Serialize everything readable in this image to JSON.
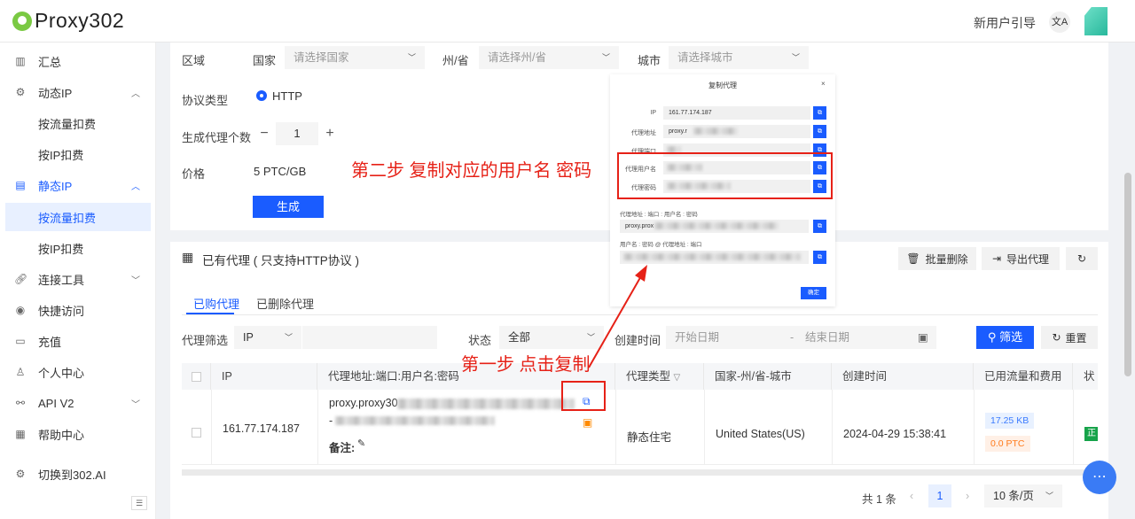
{
  "header": {
    "logo": "Proxy302",
    "guide": "新用户引导",
    "lang_icon": "translate-icon"
  },
  "sidebar": {
    "items": [
      {
        "label": "汇总",
        "icon": "bar-chart-icon"
      },
      {
        "label": "动态IP",
        "icon": "gear-icon"
      },
      {
        "label": "按流量扣费"
      },
      {
        "label": "按IP扣费"
      },
      {
        "label": "静态IP",
        "icon": "server-icon"
      },
      {
        "label": "按流量扣费"
      },
      {
        "label": "按IP扣费"
      },
      {
        "label": "连接工具",
        "icon": "link-icon"
      },
      {
        "label": "快捷访问",
        "icon": "chrome-icon"
      },
      {
        "label": "充值",
        "icon": "wallet-icon"
      },
      {
        "label": "个人中心",
        "icon": "user-icon"
      },
      {
        "label": "API V2",
        "icon": "api-icon"
      },
      {
        "label": "帮助中心",
        "icon": "book-icon"
      },
      {
        "label": "切换到302.AI",
        "icon": "switch-icon"
      }
    ]
  },
  "form": {
    "region_label": "区域",
    "country_label": "国家",
    "country_placeholder": "请选择国家",
    "state_label": "州/省",
    "state_placeholder": "请选择州/省",
    "city_label": "城市",
    "city_placeholder": "请选择城市",
    "protocol_label": "协议类型",
    "protocol_value": "HTTP",
    "count_label": "生成代理个数",
    "count_value": "1",
    "price_label": "价格",
    "price_value": "5 PTC/GB",
    "generate_button": "生成"
  },
  "proxies": {
    "title": "已有代理 ( 只支持HTTP协议 )",
    "batch_delete": "批量删除",
    "export": "导出代理",
    "tabs": [
      "已购代理",
      "已删除代理"
    ],
    "filter_label": "代理筛选",
    "filter_type": "IP",
    "status_label": "状态",
    "status_value": "全部",
    "created_label": "创建时间",
    "start_date": "开始日期",
    "date_sep": "-",
    "end_date": "结束日期",
    "search_button": "筛选",
    "reset_button": "重置",
    "columns": [
      "IP",
      "代理地址:端口:用户名:密码",
      "代理类型",
      "国家-州/省-城市",
      "创建时间",
      "已用流量和费用",
      "状态"
    ],
    "row": {
      "ip": "161.77.174.187",
      "address_prefix": "proxy.proxy30",
      "address_second": "-",
      "note_label": "备注:",
      "type": "静态住宅",
      "location": "United States(US)",
      "created": "2024-04-29 15:38:41",
      "traffic": "17.25 KB",
      "cost": "0.0 PTC",
      "status": "正"
    },
    "pager": {
      "total": "共 1 条",
      "page": "1",
      "size": "10 条/页"
    }
  },
  "modal": {
    "title": "复制代理",
    "close": "×",
    "fields": [
      {
        "label": "IP",
        "value": "161.77.174.187"
      },
      {
        "label": "代理地址",
        "value": "proxy.r"
      },
      {
        "label": "代理端口",
        "value": ""
      },
      {
        "label": "代理用户名",
        "value": ""
      },
      {
        "label": "代理密码",
        "value": ""
      }
    ],
    "line1_label": "代理地址 : 端口 : 用户名 : 密码",
    "line1_value": "proxy.prox",
    "line2_label": "用户名 : 密码 @ 代理地址 : 端口",
    "confirm": "确定"
  },
  "annotations": {
    "step2": "第二步 复制对应的用户名 密码",
    "step1": "第一步 点击复制"
  },
  "colors": {
    "primary": "#1a5cff",
    "annotation": "#e62117"
  }
}
